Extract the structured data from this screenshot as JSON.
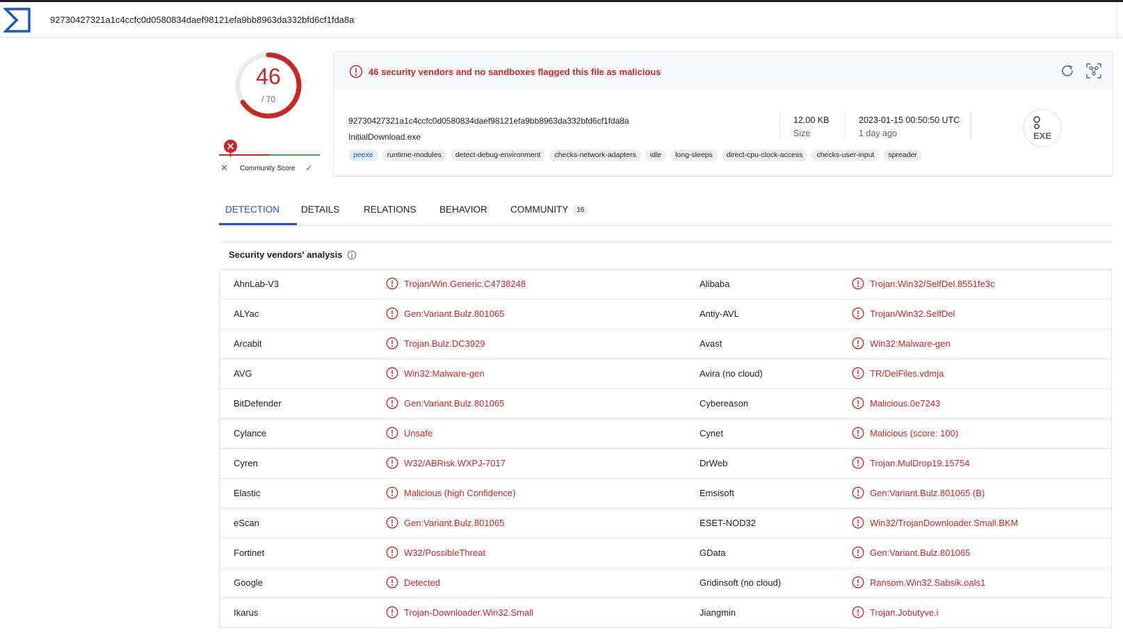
{
  "header": {
    "search_value": "92730427321a1c4ccfc0d0580834daef98121efa9bb8963da332bfd6cf1fda8a"
  },
  "colors": {
    "malicious": "#c62828",
    "accent": "#1a57c5",
    "clean": "#43a047"
  },
  "score": {
    "detections": "46",
    "total": "/ 70",
    "detection_fraction": 0.657,
    "community_label": "Community Score"
  },
  "summary": {
    "alert": "46 security vendors and no sandboxes flagged this file as malicious",
    "hash": "92730427321a1c4ccfc0d0580834daef98121efa9bb8963da332bfd6cf1fda8a",
    "filename": "InitialDownload.exe",
    "tags": [
      "peexe",
      "runtime-modules",
      "detect-debug-environment",
      "checks-network-adapters",
      "idle",
      "long-sleeps",
      "direct-cpu-clock-access",
      "checks-user-input",
      "spreader"
    ],
    "size_value": "12.00 KB",
    "size_label": "Size",
    "date_value": "2023-01-15 00:50:50 UTC",
    "date_label": "1 day ago",
    "file_type": "EXE"
  },
  "tabs": [
    {
      "label": "DETECTION",
      "active": true
    },
    {
      "label": "DETAILS"
    },
    {
      "label": "RELATIONS"
    },
    {
      "label": "BEHAVIOR"
    },
    {
      "label": "COMMUNITY",
      "badge": "16"
    }
  ],
  "section": {
    "title": "Security vendors' analysis"
  },
  "vendors": [
    [
      {
        "name": "AhnLab-V3",
        "result": "Trojan/Win.Generic.C4738248"
      },
      {
        "name": "Alibaba",
        "result": "Trojan:Win32/SelfDel.8551fe3c"
      }
    ],
    [
      {
        "name": "ALYac",
        "result": "Gen:Variant.Bulz.801065"
      },
      {
        "name": "Antiy-AVL",
        "result": "Trojan/Win32.SelfDel"
      }
    ],
    [
      {
        "name": "Arcabit",
        "result": "Trojan.Bulz.DC3929"
      },
      {
        "name": "Avast",
        "result": "Win32:Malware-gen"
      }
    ],
    [
      {
        "name": "AVG",
        "result": "Win32:Malware-gen"
      },
      {
        "name": "Avira (no cloud)",
        "result": "TR/DelFiles.vdmja"
      }
    ],
    [
      {
        "name": "BitDefender",
        "result": "Gen:Variant.Bulz.801065"
      },
      {
        "name": "Cybereason",
        "result": "Malicious.0e7243"
      }
    ],
    [
      {
        "name": "Cylance",
        "result": "Unsafe"
      },
      {
        "name": "Cynet",
        "result": "Malicious (score: 100)"
      }
    ],
    [
      {
        "name": "Cyren",
        "result": "W32/ABRisk.WXPJ-7017"
      },
      {
        "name": "DrWeb",
        "result": "Trojan.MulDrop19.15754"
      }
    ],
    [
      {
        "name": "Elastic",
        "result": "Malicious (high Confidence)"
      },
      {
        "name": "Emsisoft",
        "result": "Gen:Variant.Bulz.801065 (B)"
      }
    ],
    [
      {
        "name": "eScan",
        "result": "Gen:Variant.Bulz.801065"
      },
      {
        "name": "ESET-NOD32",
        "result": "Win32/TrojanDownloader.Small.BKM"
      }
    ],
    [
      {
        "name": "Fortinet",
        "result": "W32/PossibleThreat"
      },
      {
        "name": "GData",
        "result": "Gen:Variant.Bulz.801065"
      }
    ],
    [
      {
        "name": "Google",
        "result": "Detected"
      },
      {
        "name": "Gridinsoft (no cloud)",
        "result": "Ransom.Win32.Sabsik.oals1"
      }
    ],
    [
      {
        "name": "Ikarus",
        "result": "Trojan-Downloader.Win32.Small"
      },
      {
        "name": "Jiangmin",
        "result": "Trojan.Jobutyve.i"
      }
    ]
  ]
}
